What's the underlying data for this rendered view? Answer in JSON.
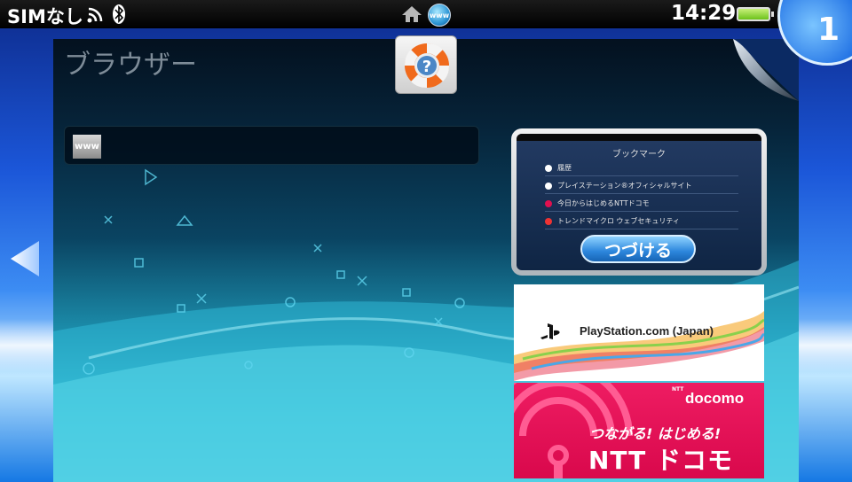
{
  "status_bar": {
    "sim": "SIMなし",
    "time": "14:29",
    "home_icon": "home-icon",
    "app_icon_text": "www"
  },
  "page_number": "1",
  "app": {
    "title": "ブラウザー",
    "help_icon": "lifebuoy-help-icon",
    "url_field": {
      "icon_text": "www",
      "value": ""
    }
  },
  "bookmark_preview": {
    "title": "ブックマーク",
    "items": [
      "履歴",
      "プレイステーション®オフィシャルサイト",
      "今日からはじめるNTTドコモ",
      "トレンドマイクロ ウェブセキュリティ"
    ],
    "continue_label": "つづける"
  },
  "banners": {
    "playstation": {
      "text": "PlayStation.com (Japan)"
    },
    "docomo": {
      "top_label": "NTT",
      "logo": "docomo",
      "tagline": "つながる! はじめる!",
      "name": "NTT ドコモ"
    }
  },
  "colors": {
    "accent_blue": "#2777e6",
    "docomo_red": "#e0104f",
    "battery_green": "#6cc21a"
  }
}
